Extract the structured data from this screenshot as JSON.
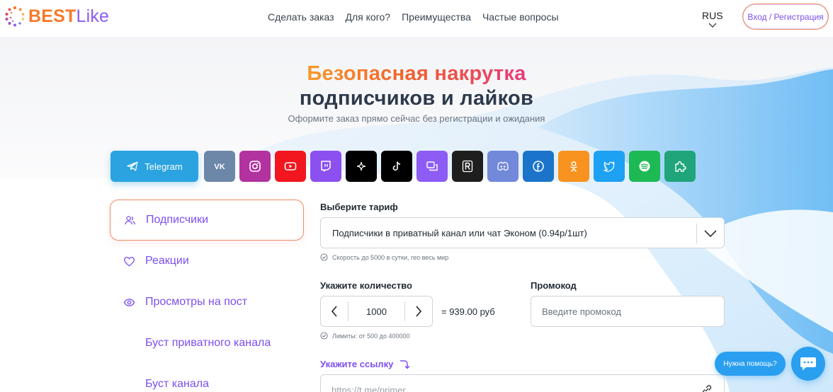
{
  "header": {
    "logo_best": "BEST",
    "logo_like": "Like",
    "nav": [
      "Сделать заказ",
      "Для кого?",
      "Преимущества",
      "Частые вопросы"
    ],
    "lang": "RUS",
    "login": "Вход / Регистрация"
  },
  "hero": {
    "title_line1": "Безопасная накрутка",
    "title_line2": "подписчиков и лайков",
    "subtitle": "Оформите заказ прямо сейчас без регистрации и ожидания"
  },
  "platforms": [
    {
      "name": "telegram",
      "label": "Telegram",
      "color": "#2aa3e0",
      "icon": "telegram-icon"
    },
    {
      "name": "vk",
      "color": "#6d87a8",
      "icon": "vk-icon"
    },
    {
      "name": "instagram",
      "color": "#b2329f",
      "icon": "instagram-icon"
    },
    {
      "name": "youtube",
      "color": "#f2161f",
      "icon": "youtube-icon"
    },
    {
      "name": "twitch",
      "color": "#8c4ff0",
      "icon": "twitch-icon"
    },
    {
      "name": "threads",
      "color": "#000000",
      "icon": "sparkle-icon"
    },
    {
      "name": "tiktok",
      "color": "#000000",
      "icon": "tiktok-icon"
    },
    {
      "name": "chat",
      "color": "#8c5cf4",
      "icon": "chat-icon"
    },
    {
      "name": "r",
      "color": "#1e1e1e",
      "icon": "r-icon"
    },
    {
      "name": "discord",
      "color": "#7289da",
      "icon": "discord-icon"
    },
    {
      "name": "facebook",
      "color": "#1b74c9",
      "icon": "facebook-icon"
    },
    {
      "name": "odnoklassniki",
      "color": "#f7931e",
      "icon": "ok-icon"
    },
    {
      "name": "twitter",
      "color": "#1da1f2",
      "icon": "twitter-icon"
    },
    {
      "name": "spotify",
      "color": "#1db954",
      "icon": "spotify-icon"
    },
    {
      "name": "other",
      "color": "#20a57b",
      "icon": "puzzle-icon"
    }
  ],
  "menu": [
    {
      "label": "Подписчики",
      "icon": "users-icon",
      "active": true
    },
    {
      "label": "Реакции",
      "icon": "heart-icon",
      "active": false
    },
    {
      "label": "Просмотры на пост",
      "icon": "eye-icon",
      "active": false
    },
    {
      "label": "Буст приватного канала",
      "icon": "",
      "active": false
    },
    {
      "label": "Буст канала",
      "icon": "",
      "active": false
    }
  ],
  "form": {
    "tariff_label": "Выберите тариф",
    "tariff_value": "Подписчики в приватный канал или чат Эконом (0.94р/1шт)",
    "tariff_hint": "Скорость до 5000 в сутки, гео весь мир",
    "qty_label": "Укажите количество",
    "qty_value": "1000",
    "price": "= 939.00 руб",
    "qty_hint": "Лимиты: от 500 до 400000",
    "promo_label": "Промокод",
    "promo_placeholder": "Введите промокод",
    "link_label": "Укажите ссылку",
    "link_placeholder": "https://t.me/primer"
  },
  "help": {
    "bubble": "Нужна помощь?"
  }
}
